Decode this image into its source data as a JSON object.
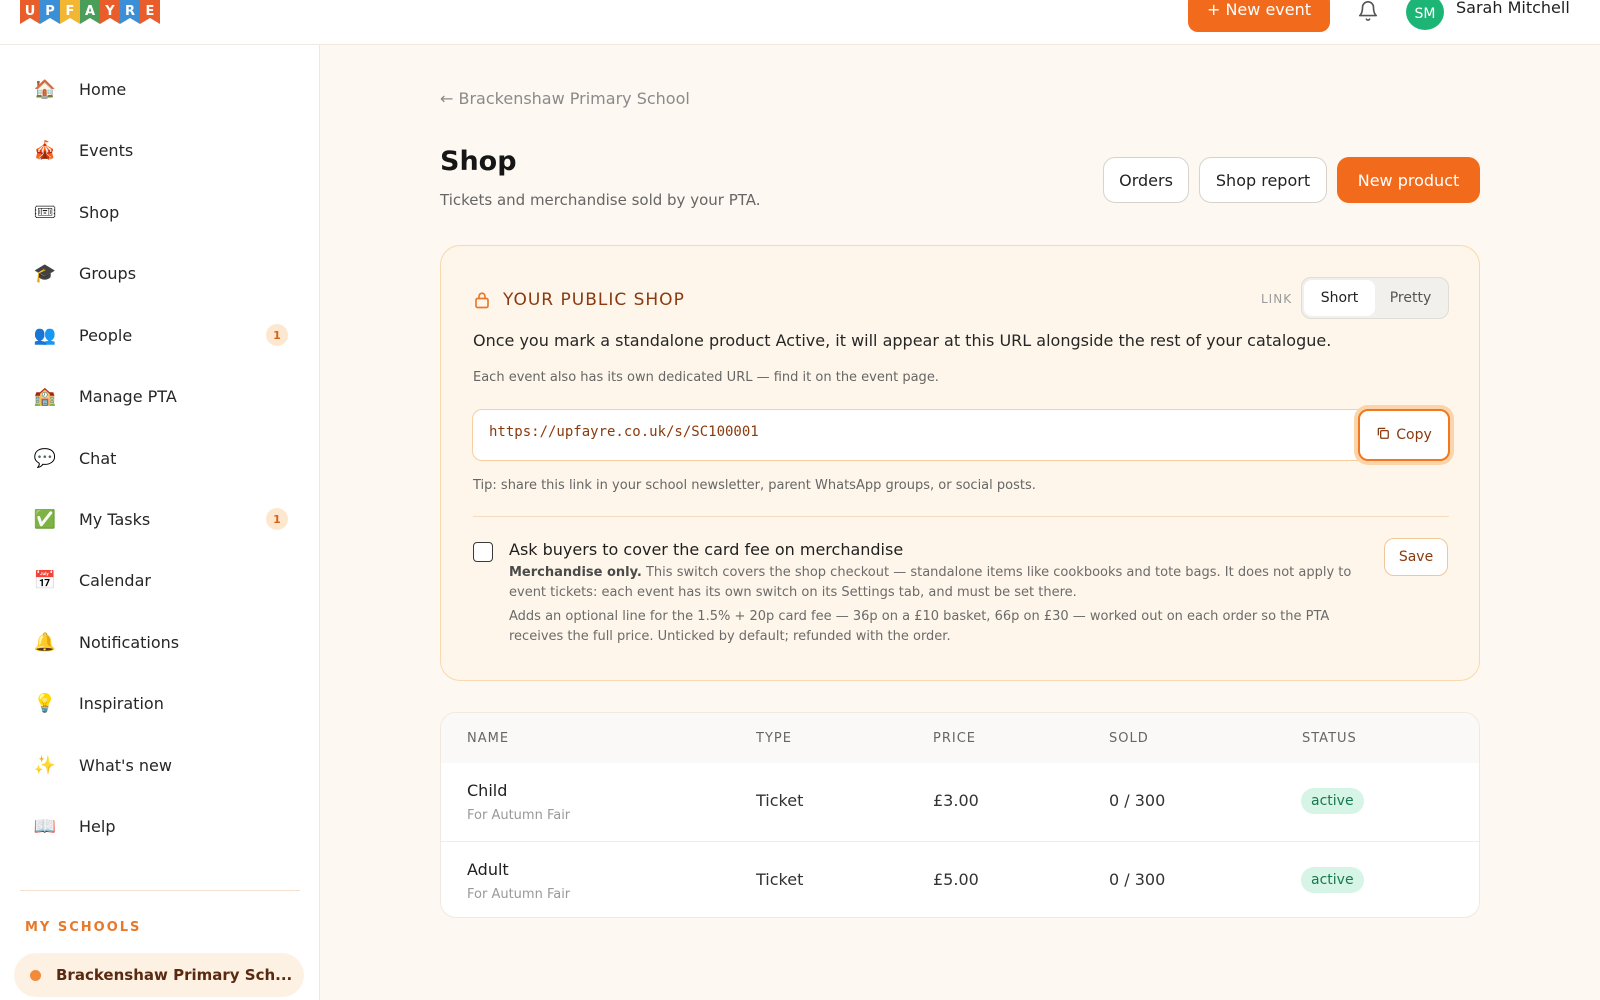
{
  "topbar": {
    "logo_letters": [
      "U",
      "P",
      "F",
      "A",
      "Y",
      "R",
      "E"
    ],
    "new_event_label": "+ New event",
    "avatar_initials": "SM",
    "user_name": "Sarah Mitchell"
  },
  "sidebar": {
    "items": [
      {
        "label": "Home",
        "icon": "house-icon",
        "badge": ""
      },
      {
        "label": "Events",
        "icon": "circus-tent-icon",
        "badge": ""
      },
      {
        "label": "Shop",
        "icon": "ticket-icon",
        "badge": ""
      },
      {
        "label": "Groups",
        "icon": "graduation-cap-icon",
        "badge": ""
      },
      {
        "label": "People",
        "icon": "people-icon",
        "badge": "1"
      },
      {
        "label": "Manage PTA",
        "icon": "school-building-icon",
        "badge": ""
      },
      {
        "label": "Chat",
        "icon": "speech-bubble-icon",
        "badge": ""
      },
      {
        "label": "My Tasks",
        "icon": "check-mark-icon",
        "badge": "1"
      },
      {
        "label": "Calendar",
        "icon": "calendar-icon",
        "badge": ""
      },
      {
        "label": "Notifications",
        "icon": "bell-icon",
        "badge": ""
      },
      {
        "label": "Inspiration",
        "icon": "light-bulb-icon",
        "badge": ""
      },
      {
        "label": "What's new",
        "icon": "sparkles-icon",
        "badge": ""
      },
      {
        "label": "Help",
        "icon": "book-icon",
        "badge": ""
      }
    ],
    "my_schools_heading": "MY SCHOOLS",
    "school_name": "Brackenshaw Primary Sch..."
  },
  "main": {
    "breadcrumb": "← Brackenshaw Primary School",
    "title": "Shop",
    "subtitle": "Tickets and merchandise sold by your PTA.",
    "orders_label": "Orders",
    "shop_report_label": "Shop report",
    "new_product_label": "New product"
  },
  "public_shop": {
    "title": "YOUR PUBLIC SHOP",
    "link_label": "LINK",
    "link_options": [
      "Short",
      "Pretty"
    ],
    "selected_option": "Short",
    "info_text": "Once you mark a standalone product Active, it will appear at this URL alongside the rest of your catalogue.",
    "event_note": "Each event also has its own dedicated URL — find it on the event page.",
    "url": "https://upfayre.co.uk/s/SC100001",
    "copy_label": "Copy",
    "tip": "Tip: share this link in your school newsletter, parent WhatsApp groups, or social posts.",
    "checkbox_label": "Ask buyers to cover the card fee on merchandise",
    "checkbox_checked": false,
    "desc1_bold": "Merchandise only.",
    "desc1": " This switch covers the shop checkout — standalone items like cookbooks and tote bags. It does not apply to event tickets: each event has its own switch on its Settings tab, and must be set there.",
    "desc2": "Adds an optional line for the 1.5% + 20p card fee — 36p on a £10 basket, 66p on £30 — worked out on each order so the PTA receives the full price. Unticked by default; refunded with the order.",
    "save_label": "Save"
  },
  "products_table": {
    "headers": [
      "NAME",
      "TYPE",
      "PRICE",
      "SOLD",
      "STATUS"
    ],
    "rows": [
      {
        "name": "Child",
        "sub": "For Autumn Fair",
        "type": "Ticket",
        "price": "£3.00",
        "sold": "0 / 300",
        "status": "active"
      },
      {
        "name": "Adult",
        "sub": "For Autumn Fair",
        "type": "Ticket",
        "price": "£5.00",
        "sold": "0 / 300",
        "status": "active"
      }
    ]
  },
  "colors": {
    "accent": "#f26a1b",
    "card_bg": "#fef6ea",
    "status_active_bg": "#d6f5e6",
    "avatar_bg": "#1db575"
  }
}
